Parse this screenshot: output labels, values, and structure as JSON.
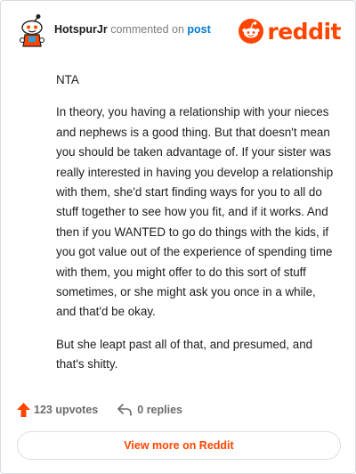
{
  "header": {
    "username": "HotspurJr",
    "commented_text": "commented on",
    "post_link": "post",
    "logo_text": "reddit",
    "avatar_icon": "snoo-avatar-icon",
    "logo_icon": "reddit-snoo-logo-icon"
  },
  "comment": {
    "paragraphs": [
      "NTA",
      "In theory, you having a relationship with your nieces and nephews is a good thing. But that doesn't mean you should be taken advantage of. If your sister was really interested in having you develop a relationship with them, she'd start finding ways for you to all do stuff together to see how you fit, and if it works. And then if you WANTED to go do things with the kids, if you got value out of the experience of spending time with them, you might offer to do this sort of stuff sometimes, or she might ask you once in a while, and that'd be okay.",
      "But she leapt past all of that, and presumed, and that's shitty."
    ]
  },
  "footer": {
    "upvotes": "123 upvotes",
    "replies": "0 replies",
    "upvote_icon": "upvote-arrow-icon",
    "reply_icon": "reply-arrow-icon"
  },
  "cta": {
    "label": "View more on Reddit"
  },
  "colors": {
    "brand": "#ff4500",
    "link": "#0079d3",
    "text": "#1c1c1c",
    "muted": "#7c7c7c"
  }
}
